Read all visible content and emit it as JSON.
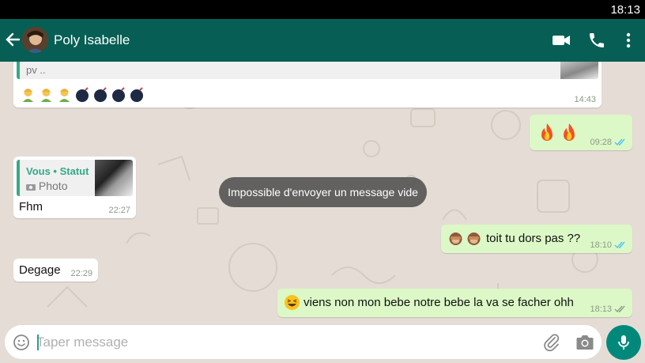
{
  "status_bar": {
    "time": "18:13"
  },
  "header": {
    "contact_name": "Poly Isabelle"
  },
  "messages": {
    "m1": {
      "preview_text": "pv ..",
      "time": "14:43"
    },
    "m2": {
      "time": "09:28"
    },
    "m3": {
      "quote_title": "Vous • Statut",
      "quote_subtitle": "Photo",
      "text": "Fhm",
      "time": "22:27"
    },
    "m4": {
      "text": "toit tu dors pas ??",
      "time": "18:10"
    },
    "m5": {
      "text": "Degage",
      "time": "22:29"
    },
    "m6": {
      "text": "viens non mon bebe notre bebe la va se facher ohh",
      "time": "18:13"
    }
  },
  "toast": {
    "text": "Impossible d'envoyer un message vide"
  },
  "composer": {
    "placeholder": "Taper message"
  },
  "colors": {
    "header": "#075e54",
    "chat_bg": "#e5ddd5",
    "outgoing": "#dcf8c6",
    "read_ticks": "#4fc3f7",
    "mic": "#00897b"
  }
}
